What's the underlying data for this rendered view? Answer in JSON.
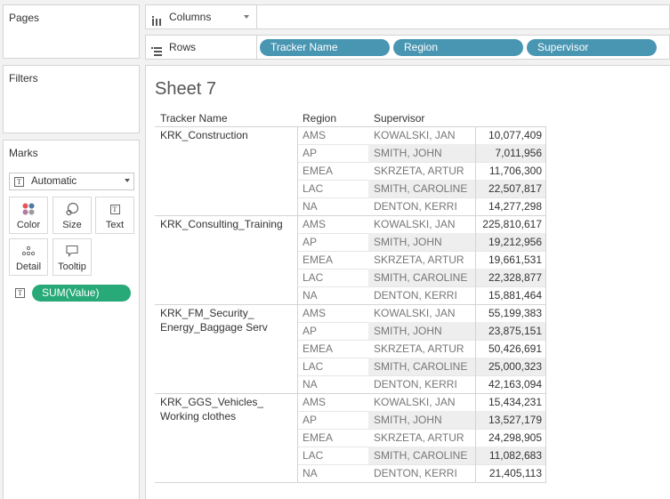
{
  "sidebar": {
    "pages_title": "Pages",
    "filters_title": "Filters",
    "marks": {
      "title": "Marks",
      "mark_type": "Automatic",
      "buttons": [
        {
          "label": "Color",
          "icon": "color-dots-icon"
        },
        {
          "label": "Size",
          "icon": "size-icon"
        },
        {
          "label": "Text",
          "icon": "text-icon"
        },
        {
          "label": "Detail",
          "icon": "detail-dots-icon"
        },
        {
          "label": "Tooltip",
          "icon": "tooltip-icon"
        }
      ],
      "measure_pill": "SUM(Value)"
    }
  },
  "shelves": {
    "columns_label": "Columns",
    "rows_label": "Rows",
    "row_pills": [
      "Tracker Name",
      "Region",
      "Supervisor"
    ]
  },
  "sheet": {
    "title": "Sheet 7",
    "headers": {
      "tracker": "Tracker Name",
      "region": "Region",
      "supervisor": "Supervisor"
    },
    "groups": [
      {
        "tracker_lines": [
          "KRK_Construction"
        ],
        "rows": [
          {
            "region": "AMS",
            "supervisor": "KOWALSKI, JAN",
            "value": "10,077,409"
          },
          {
            "region": "AP",
            "supervisor": "SMITH, JOHN",
            "value": "7,011,956"
          },
          {
            "region": "EMEA",
            "supervisor": "SKRZETA, ARTUR",
            "value": "11,706,300"
          },
          {
            "region": "LAC",
            "supervisor": "SMITH, CAROLINE",
            "value": "22,507,817"
          },
          {
            "region": "NA",
            "supervisor": "DENTON, KERRI",
            "value": "14,277,298"
          }
        ]
      },
      {
        "tracker_lines": [
          "KRK_Consulting_Training"
        ],
        "rows": [
          {
            "region": "AMS",
            "supervisor": "KOWALSKI, JAN",
            "value": "225,810,617"
          },
          {
            "region": "AP",
            "supervisor": "SMITH, JOHN",
            "value": "19,212,956"
          },
          {
            "region": "EMEA",
            "supervisor": "SKRZETA, ARTUR",
            "value": "19,661,531"
          },
          {
            "region": "LAC",
            "supervisor": "SMITH, CAROLINE",
            "value": "22,328,877"
          },
          {
            "region": "NA",
            "supervisor": "DENTON, KERRI",
            "value": "15,881,464"
          }
        ]
      },
      {
        "tracker_lines": [
          "KRK_FM_Security_",
          "Energy_Baggage Serv"
        ],
        "rows": [
          {
            "region": "AMS",
            "supervisor": "KOWALSKI, JAN",
            "value": "55,199,383"
          },
          {
            "region": "AP",
            "supervisor": "SMITH, JOHN",
            "value": "23,875,151"
          },
          {
            "region": "EMEA",
            "supervisor": "SKRZETA, ARTUR",
            "value": "50,426,691"
          },
          {
            "region": "LAC",
            "supervisor": "SMITH, CAROLINE",
            "value": "25,000,323"
          },
          {
            "region": "NA",
            "supervisor": "DENTON, KERRI",
            "value": "42,163,094"
          }
        ]
      },
      {
        "tracker_lines": [
          "KRK_GGS_Vehicles_",
          "Working clothes"
        ],
        "rows": [
          {
            "region": "AMS",
            "supervisor": "KOWALSKI, JAN",
            "value": "15,434,231"
          },
          {
            "region": "AP",
            "supervisor": "SMITH, JOHN",
            "value": "13,527,179"
          },
          {
            "region": "EMEA",
            "supervisor": "SKRZETA, ARTUR",
            "value": "24,298,905"
          },
          {
            "region": "LAC",
            "supervisor": "SMITH, CAROLINE",
            "value": "11,082,683"
          },
          {
            "region": "NA",
            "supervisor": "DENTON, KERRI",
            "value": "21,405,113"
          }
        ]
      }
    ]
  }
}
